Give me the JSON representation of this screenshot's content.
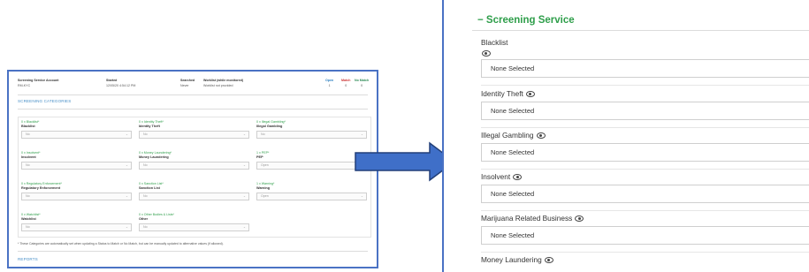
{
  "left_panel": {
    "header": [
      {
        "label": "Screening Service Account",
        "value": "RM-KYC"
      },
      {
        "label": "Started",
        "value": "12/05/20 4:54:12 PM"
      },
      {
        "label": "Searched",
        "value": "Never"
      },
      {
        "label": "Worklist (while monitored)",
        "value": "Worklist not provided"
      },
      {
        "label": "Open",
        "value": "1"
      },
      {
        "label": "Match",
        "value": "0"
      },
      {
        "label": "No Match",
        "value": "0"
      }
    ],
    "section_title": "SCREENING CATEGORIES",
    "categories": [
      {
        "count": "0 x Blacklist*",
        "name": "Blacklist",
        "value": "No"
      },
      {
        "count": "0 x Identity Theft*",
        "name": "Identity Theft",
        "value": "No"
      },
      {
        "count": "0 x Illegal Gambling*",
        "name": "Illegal Gambling",
        "value": "No"
      },
      {
        "count": "0 x Insolvent*",
        "name": "Insolvent",
        "value": "No"
      },
      {
        "count": "0 x Money Laundering*",
        "name": "Money Laundering",
        "value": "No"
      },
      {
        "count": "1 x PEP*",
        "name": "PEP",
        "value": "Open"
      },
      {
        "count": "0 x Regulatory Enforcement*",
        "name": "Regulatory Enforcement",
        "value": "No"
      },
      {
        "count": "0 x Sanction List*",
        "name": "Sanction List",
        "value": "No"
      },
      {
        "count": "1 x Warning*",
        "name": "Warning",
        "value": "Open"
      },
      {
        "count": "0 x Watchlist*",
        "name": "Watchlist",
        "value": "No"
      },
      {
        "count": "0 x Other Bodies & Lists*",
        "name": "Other",
        "value": "No"
      }
    ],
    "footnote": "* These Categories are automatically set when updating a Status to Match or No Match, but can be manually updated to alternative values (if allowed).",
    "reports_title": "REPORTS"
  },
  "right_panel": {
    "title": "− Screening Service",
    "fields": [
      {
        "label": "Blacklist",
        "value": "None Selected"
      },
      {
        "label": "Identity Theft",
        "value": "None Selected"
      },
      {
        "label": "Illegal Gambling",
        "value": "None Selected"
      },
      {
        "label": "Insolvent",
        "value": "None Selected"
      },
      {
        "label": "Marijuana Related Business",
        "value": "None Selected"
      },
      {
        "label": "Money Laundering",
        "value": ""
      }
    ]
  },
  "colors": {
    "accent_green": "#2e9e4a",
    "arrow_blue": "#3f6fc8",
    "frame_blue": "#4a72c4"
  },
  "icons": {
    "visibility": "eye-icon",
    "dropdown": "chevron-down-icon"
  }
}
